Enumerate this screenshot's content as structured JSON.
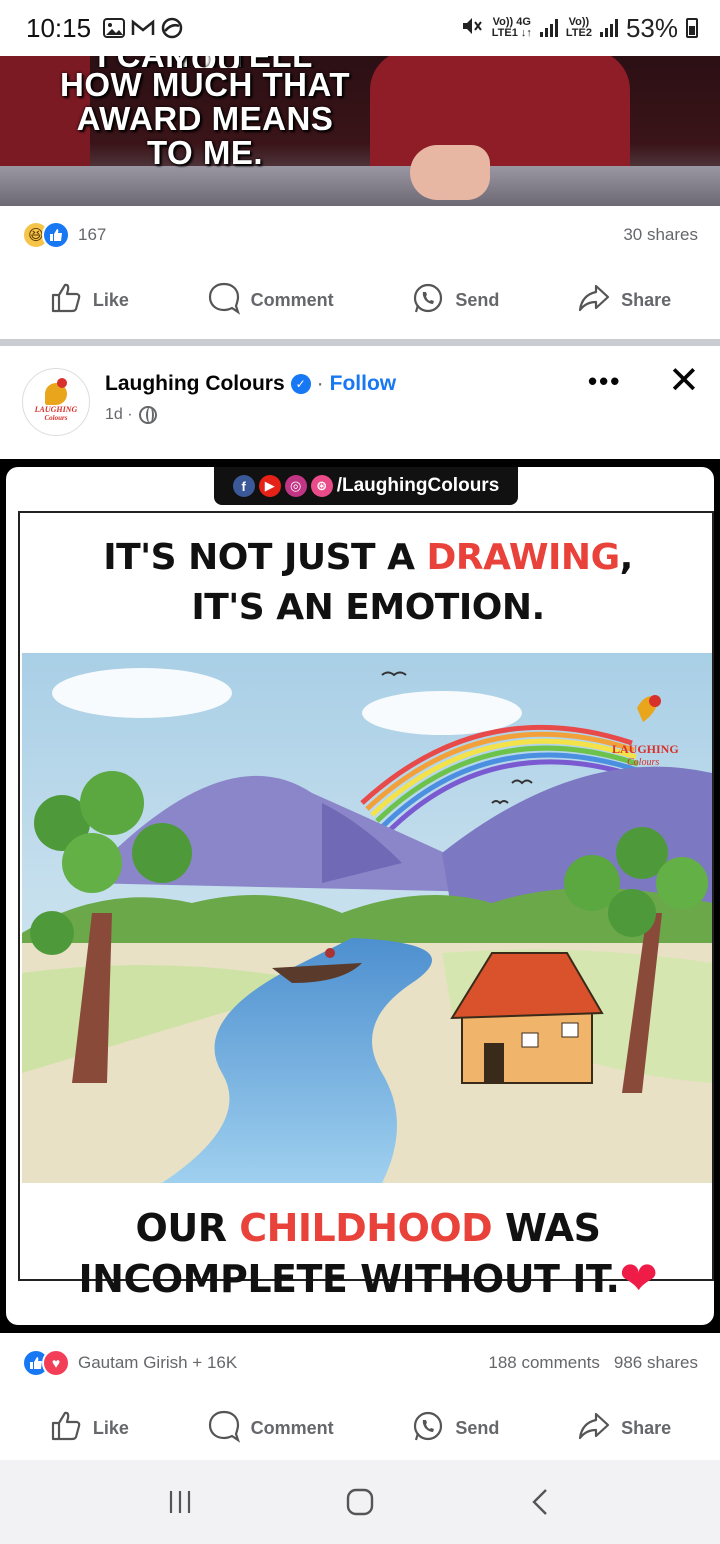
{
  "status_bar": {
    "time": "10:15",
    "left_icons": [
      "gallery-icon",
      "gmail-icon",
      "chrome-like-icon"
    ],
    "sim1_top": "Vo))",
    "sim1_mid": "4G",
    "sim1_bottom": "LTE1",
    "sim2_top": "Vo))",
    "sim2_bottom": "LTE2",
    "battery": "53%"
  },
  "prev_post": {
    "caption_cut": "I CAN'T TELL YOU",
    "caption": "HOW MUCH THAT AWARD MEANS TO ME.",
    "reaction_count": "167",
    "shares": "30 shares",
    "reactions": [
      "haha",
      "like"
    ]
  },
  "actions": {
    "like": "Like",
    "comment": "Comment",
    "send": "Send",
    "share": "Share"
  },
  "post": {
    "page_name": "Laughing Colours",
    "follow": "Follow",
    "separator": "·",
    "time": "1d ·",
    "more": "•••",
    "close": "✕",
    "avatar_text": "LAUGHING",
    "avatar_sub": "Colours",
    "image": {
      "social_handle": "/LaughingColours",
      "headline_line1_a": "IT'S NOT JUST A ",
      "headline_line1_b": "DRAWING",
      "headline_line1_c": ",",
      "headline_line2": "IT'S AN EMOTION.",
      "bottom_line1_a": "OUR ",
      "bottom_line1_b": "CHILDHOOD",
      "bottom_line1_c": " WAS",
      "bottom_line2": "INCOMPLETE WITHOUT IT.",
      "watermark": "LAUGHING",
      "watermark_sub": "Colours"
    },
    "reactors": "Gautam Girish + 16K",
    "comments": "188 comments",
    "shares": "986 shares",
    "reactions": [
      "like",
      "love"
    ]
  },
  "colors": {
    "facebook_blue": "#1877f2",
    "accent_red": "#e8423a",
    "meta_gray": "#65676b"
  }
}
